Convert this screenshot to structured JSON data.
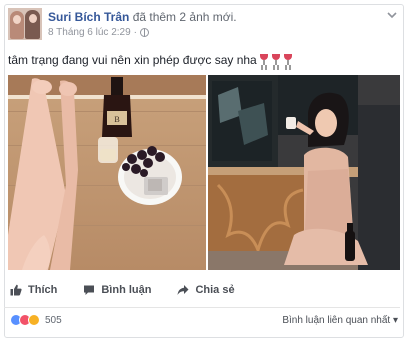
{
  "post": {
    "author": "Suri Bích Trân",
    "action": " đã thêm 2 ảnh mới.",
    "timestamp": "8 Tháng 6 lúc 2:29",
    "meta_sep": " · ",
    "privacy_icon": "globe-icon",
    "text": "tâm trạng đang vui nên xin phép được say nha",
    "emojis": [
      "wine-glass-icon",
      "wine-glass-icon",
      "wine-glass-icon"
    ],
    "photos": [
      "photo-legs-wine-table",
      "photo-woman-drinking-wine"
    ]
  },
  "actions": {
    "like": "Thích",
    "comment": "Bình luận",
    "share": "Chia sẻ"
  },
  "reactions": {
    "types": [
      "like",
      "love",
      "wow"
    ],
    "count": "505",
    "sort_label": "Bình luận liên quan nhất"
  },
  "colors": {
    "link": "#365899",
    "muted": "#90949c",
    "action_text": "#4b4f56",
    "like_blue": "#5890ff",
    "love_red": "#f25268",
    "wow_yellow": "#f7b125"
  }
}
